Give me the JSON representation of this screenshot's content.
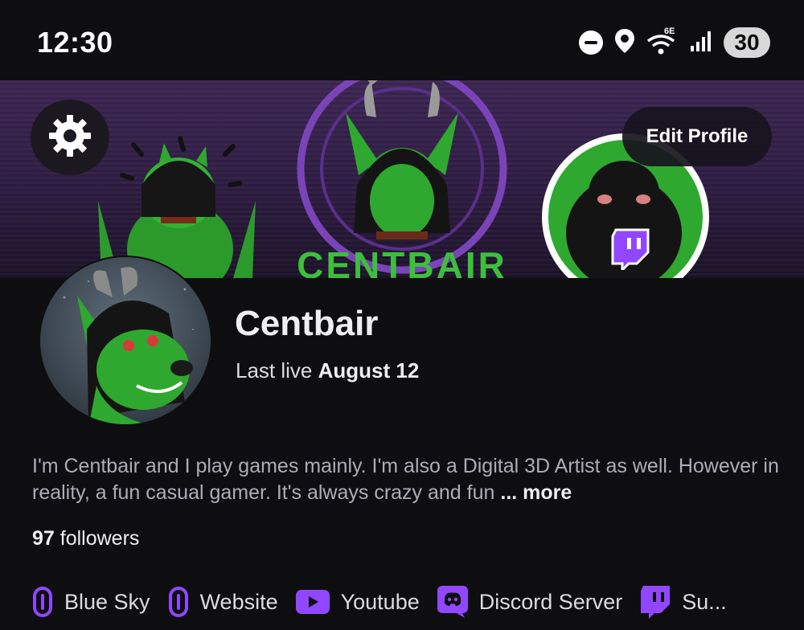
{
  "status_bar": {
    "time": "12:30",
    "wifi_label": "6E",
    "battery": "30",
    "icons": [
      "do-not-disturb-icon",
      "location-icon",
      "wifi-icon",
      "signal-icon",
      "battery-icon"
    ]
  },
  "banner": {
    "logo_text": "CENTBAIR",
    "icons": [
      "settings-icon",
      "twitch-icon"
    ]
  },
  "header": {
    "edit_profile_label": "Edit Profile"
  },
  "profile": {
    "name": "Centbair",
    "last_live_prefix": "Last live",
    "last_live_date": "August 12",
    "bio_text": "I'm Centbair and I play games mainly. I'm also a Digital 3D Artist as well. However in reality, a fun casual gamer. It's always crazy and fun",
    "bio_ellipsis": "...",
    "bio_more": "more",
    "followers_count": "97",
    "followers_label": "followers"
  },
  "links": [
    {
      "label": "Blue Sky",
      "icon": "link-icon"
    },
    {
      "label": "Website",
      "icon": "link-icon"
    },
    {
      "label": "Youtube",
      "icon": "youtube-icon"
    },
    {
      "label": "Discord Server",
      "icon": "discord-icon"
    },
    {
      "label": "Su...",
      "icon": "twitch-icon"
    }
  ],
  "colors": {
    "background": "#0e0e10",
    "accent_purple": "#9147ff",
    "banner_purple": "#3a2450",
    "avatar_green": "#2fa82f"
  }
}
